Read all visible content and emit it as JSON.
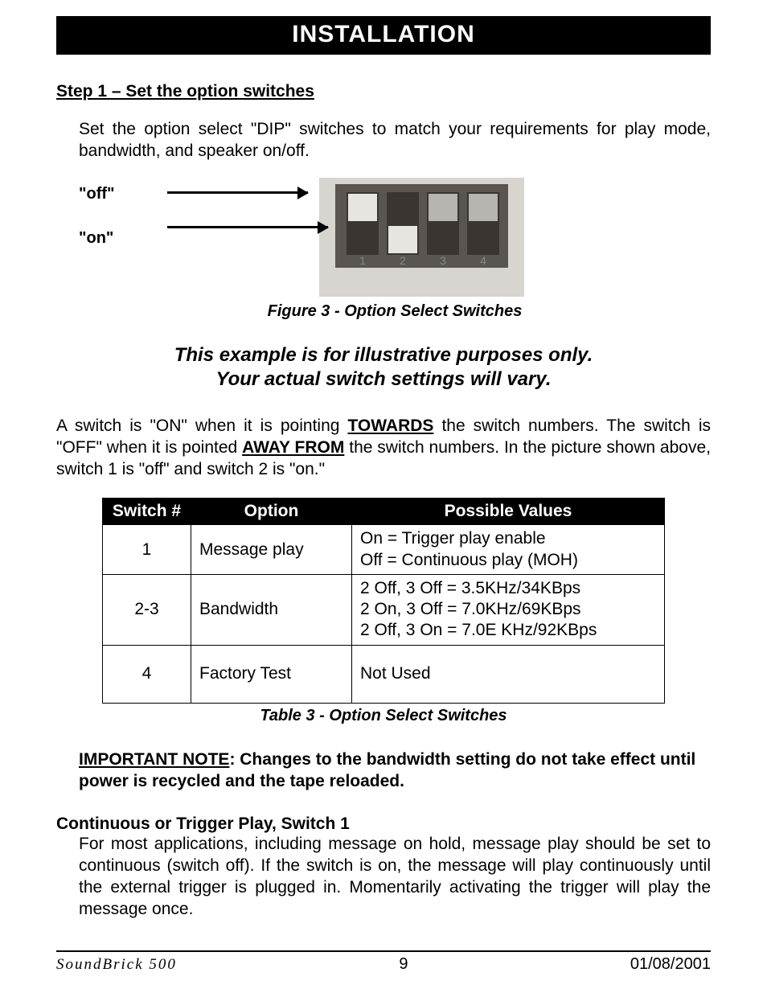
{
  "banner": "INSTALLATION",
  "step1": {
    "heading": "Step 1 – Set the option switches",
    "para": "Set the option select \"DIP\" switches to match your requirements for play mode, bandwidth, and speaker on/off."
  },
  "figure": {
    "off_label": "\"off\"",
    "on_label": "\"on\"",
    "caption": "Figure 3 - Option Select Switches"
  },
  "illustrative_line1": "This example is for illustrative purposes only.",
  "illustrative_line2": "Your actual switch settings will vary.",
  "switch_desc_1": "A switch is \"ON\" when it is pointing ",
  "towards": "TOWARDS",
  "switch_desc_2": " the switch numbers. The switch is \"OFF\" when it is pointed ",
  "away_from": "AWAY FROM",
  "switch_desc_3": " the switch numbers. In the picture shown above, switch 1 is \"off\" and switch 2 is \"on.\"",
  "table": {
    "headers": {
      "sw": "Switch #",
      "op": "Option",
      "pv": "Possible Values"
    },
    "rows": [
      {
        "sw": "1",
        "op": "Message play",
        "pv": "On = Trigger play enable\nOff = Continuous play (MOH)"
      },
      {
        "sw": "2-3",
        "op": "Bandwidth",
        "pv": "2 Off, 3 Off = 3.5KHz/34KBps\n2 On, 3 Off = 7.0KHz/69KBps\n2 Off, 3 On = 7.0E KHz/92KBps"
      },
      {
        "sw": "4",
        "op": "Factory Test",
        "pv": "Not Used"
      }
    ],
    "caption": "Table 3 - Option Select Switches"
  },
  "important": {
    "lead": "IMPORTANT NOTE",
    "text": ":  Changes to the bandwidth setting do not take effect until power is recycled and the tape reloaded."
  },
  "cont_trigger": {
    "heading": "Continuous or Trigger Play, Switch 1",
    "para": "For most applications, including message on hold, message play should be set to continuous (switch off).  If the switch is on, the message will play continuously until the external trigger is plugged in.  Momentarily activating the trigger will play the message once."
  },
  "footer": {
    "left": "SoundBrick  500",
    "center": "9",
    "right": "01/08/2001"
  }
}
